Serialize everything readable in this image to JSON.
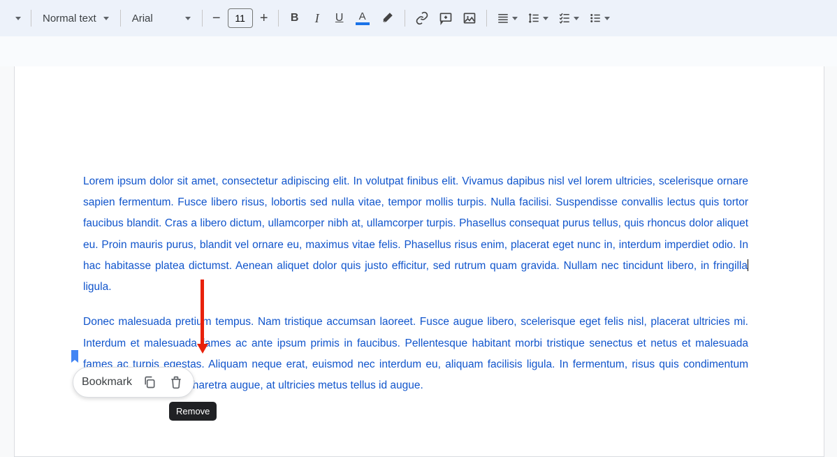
{
  "toolbar": {
    "style_label": "Normal text",
    "font_label": "Arial",
    "font_size": "11"
  },
  "document": {
    "para1": "Lorem ipsum dolor sit amet, consectetur adipiscing elit. In volutpat finibus elit. Vivamus dapibus nisl vel lorem ultricies, scelerisque ornare sapien fermentum. Fusce libero risus, lobortis sed nulla vitae, tempor mollis turpis. Nulla facilisi. Suspendisse convallis lectus quis tortor faucibus blandit. Cras a libero dictum, ullamcorper nibh at, ullamcorper turpis. Phasellus consequat purus tellus, quis rhoncus dolor aliquet eu. Proin mauris purus, blandit vel ornare eu, maximus vitae felis. Phasellus risus enim, placerat eget nunc in, interdum imperdiet odio. In hac habitasse platea dictumst. Aenean aliquet dolor quis justo efficitur, sed rutrum quam gravida. Nullam nec tincidunt libero, in fringilla",
    "para1_tail": "ligula.",
    "para2": "Donec malesuada pretium tempus. Nam tristique accumsan laoreet. Fusce augue libero, scelerisque eget felis nisl, placerat ultricies mi. Interdum et malesuada fames ac ante ipsum primis in faucibus. Pellentesque habitant morbi tristique senectus et netus et malesuada fames ac turpis egestas. Aliquam neque erat, euismod nec interdum eu, aliquam facilisis ligula. In fermentum, risus quis condimentum imperdiet, nibh turpis pharetra augue, at ultricies metus tellus id augue."
  },
  "bookmark": {
    "label": "Bookmark",
    "tooltip": "Remove"
  }
}
